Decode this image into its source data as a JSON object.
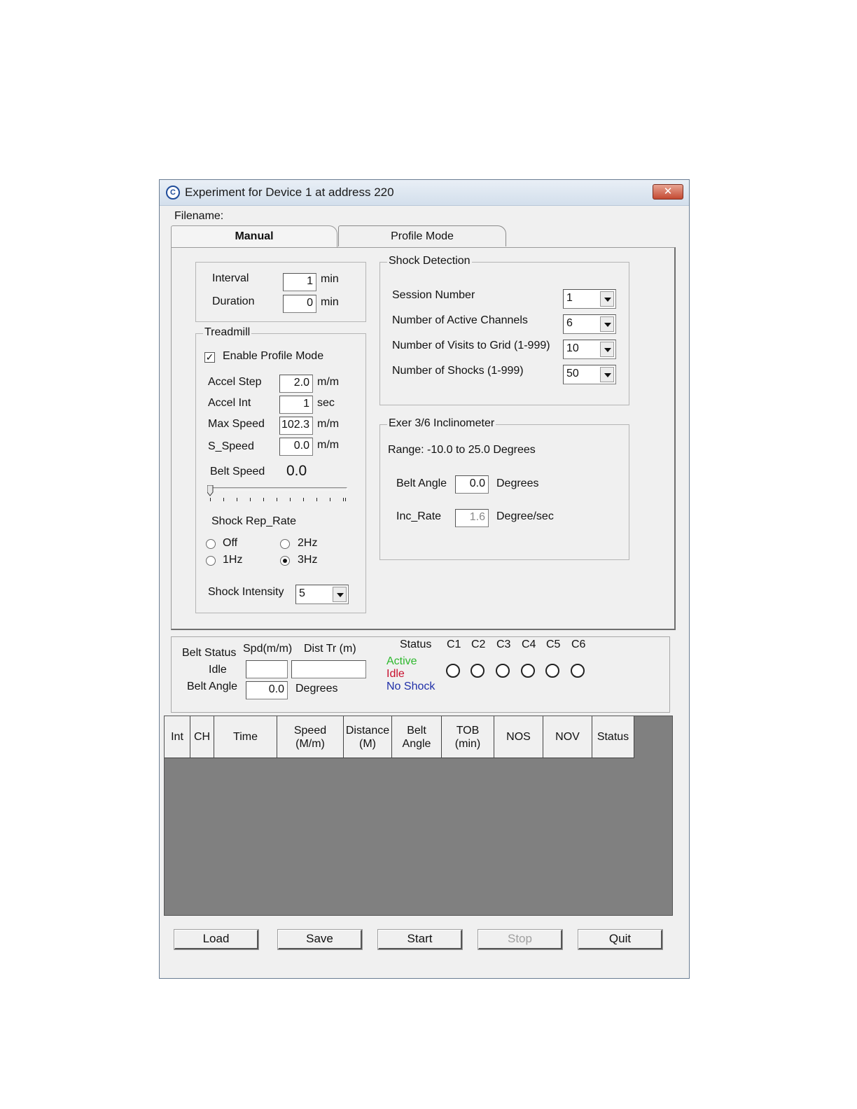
{
  "window": {
    "title": "Experiment for Device 1 at address 220",
    "app_icon": "app-logo-icon",
    "close_icon": "close-icon",
    "close_label": "✕"
  },
  "filename_label": "Filename:",
  "tabs": [
    {
      "label": "Manual",
      "active": true
    },
    {
      "label": "Profile Mode",
      "active": false
    }
  ],
  "timing": {
    "interval_label": "Interval",
    "interval_value": "1",
    "interval_unit": "min",
    "duration_label": "Duration",
    "duration_value": "0",
    "duration_unit": "min"
  },
  "treadmill": {
    "title": "Treadmill",
    "enable_profile_label": "Enable Profile Mode",
    "enable_profile_checked": true,
    "check_mark": "✓",
    "accel_step_label": "Accel Step",
    "accel_step_value": "2.0",
    "accel_step_unit": "m/m",
    "accel_int_label": "Accel Int",
    "accel_int_value": "1",
    "accel_int_unit": "sec",
    "max_speed_label": "Max Speed",
    "max_speed_value": "102.3",
    "max_speed_unit": "m/m",
    "s_speed_label": "S_Speed",
    "s_speed_value": "0.0",
    "s_speed_unit": "m/m",
    "belt_speed_label": "Belt Speed",
    "belt_speed_value": "0.0",
    "slider_level": 0,
    "shock_rep_rate_label": "Shock Rep_Rate",
    "rate_options": [
      {
        "label": "Off",
        "selected": false
      },
      {
        "label": "2Hz",
        "selected": false
      },
      {
        "label": "1Hz",
        "selected": false
      },
      {
        "label": "3Hz",
        "selected": true
      }
    ],
    "shock_intensity_label": "Shock Intensity",
    "shock_intensity_value": "5"
  },
  "shock_detection": {
    "title": "Shock Detection",
    "session_number_label": "Session Number",
    "session_number_value": "1",
    "active_channels_label": "Number of Active Channels",
    "active_channels_value": "6",
    "visits_label": "Number of Visits to Grid (1-999)",
    "visits_value": "10",
    "shocks_label": "Number of Shocks (1-999)",
    "shocks_value": "50"
  },
  "inclinometer": {
    "title": "Exer 3/6 Inclinometer",
    "range_text": "Range:  -10.0 to 25.0 Degrees",
    "belt_angle_label": "Belt Angle",
    "belt_angle_value": "0.0",
    "belt_angle_unit": "Degrees",
    "inc_rate_label": "Inc_Rate",
    "inc_rate_value": "1.6",
    "inc_rate_unit": "Degree/sec"
  },
  "status_panel": {
    "belt_status_label": "Belt Status",
    "belt_status_value": "Idle",
    "spd_label": "Spd(m/m)",
    "spd_value": "",
    "dist_label": "Dist Tr (m)",
    "dist_value": "",
    "belt_angle_label": "Belt Angle",
    "belt_angle_value": "0.0",
    "belt_angle_unit": "Degrees",
    "status_label": "Status",
    "legend": [
      {
        "label": "Active",
        "color": "#2db82d"
      },
      {
        "label": "Idle",
        "color": "#c8102e"
      },
      {
        "label": "No Shock",
        "color": "#1f2fa8"
      }
    ],
    "channels": [
      "C1",
      "C2",
      "C3",
      "C4",
      "C5",
      "C6"
    ]
  },
  "table": {
    "headers": [
      {
        "line1": "Int",
        "line2": ""
      },
      {
        "line1": "CH",
        "line2": ""
      },
      {
        "line1": "Time",
        "line2": ""
      },
      {
        "line1": "Speed",
        "line2": "(M/m)"
      },
      {
        "line1": "Distance",
        "line2": "(M)"
      },
      {
        "line1": "Belt",
        "line2": "Angle"
      },
      {
        "line1": "TOB",
        "line2": "(min)"
      },
      {
        "line1": "NOS",
        "line2": ""
      },
      {
        "line1": "NOV",
        "line2": ""
      },
      {
        "line1": "Status",
        "line2": ""
      }
    ],
    "rows": []
  },
  "buttons": [
    {
      "label": "Load",
      "enabled": true
    },
    {
      "label": "Save",
      "enabled": true
    },
    {
      "label": "Start",
      "enabled": true
    },
    {
      "label": "Stop",
      "enabled": false
    },
    {
      "label": "Quit",
      "enabled": true
    }
  ]
}
